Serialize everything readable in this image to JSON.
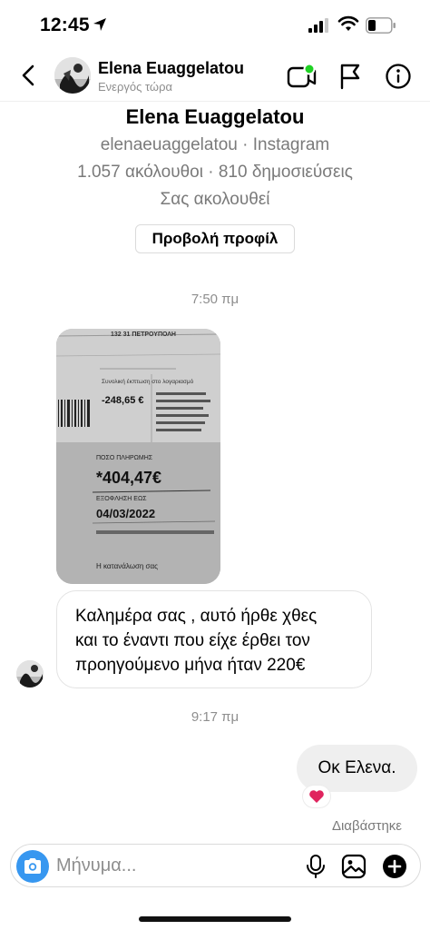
{
  "status_bar": {
    "time": "12:45"
  },
  "header": {
    "name": "Elena Euaggelatou",
    "status": "Ενεργός τώρα"
  },
  "profile": {
    "name": "Elena Euaggelatou",
    "handle": "elenaeuaggelatou · Instagram",
    "stats": "1.057 ακόλουθοι · 810 δημοσιεύσεις",
    "follows": "Σας ακολουθεί",
    "button": "Προβολή προφίλ"
  },
  "messages": {
    "timestamp1": "7:50 πμ",
    "photo": {
      "header_line": "132 31 ΠΕΤΡΟΥΠΟΛΗ",
      "discount_label": "Συνολική έκπτωση στο λογαριασμό",
      "discount_value": "-248,65 €",
      "pay_label": "ΠΟΣΟ ΠΛΗΡΩΜΗΣ",
      "pay_value": "*404,47€",
      "due_label": "ΕΞΟΦΛΗΣΗ ΕΩΣ",
      "due_value": "04/03/2022",
      "footer": "Η κατανάλωση σας"
    },
    "incoming_lines": [
      "Καλημέρα σας , αυτό ήρθε χθες",
      "και το έναντι που είχε έρθει τον",
      "προηγούμενο μήνα ήταν 220€"
    ],
    "timestamp2": "9:17 πμ",
    "outgoing": "Οκ Ελενα.",
    "reaction": "❤️",
    "seen": "Διαβάστηκε"
  },
  "composer": {
    "placeholder": "Μήνυμα..."
  },
  "colors": {
    "accent": "#3797f0",
    "online": "#1fd224",
    "reaction": "#e0245e"
  },
  "icons": [
    "location-arrow-icon",
    "signal-icon",
    "wifi-icon",
    "battery-icon",
    "back-icon",
    "video-call-icon",
    "flag-icon",
    "info-icon",
    "camera-icon",
    "microphone-icon",
    "gallery-icon",
    "plus-icon",
    "heart-icon"
  ]
}
